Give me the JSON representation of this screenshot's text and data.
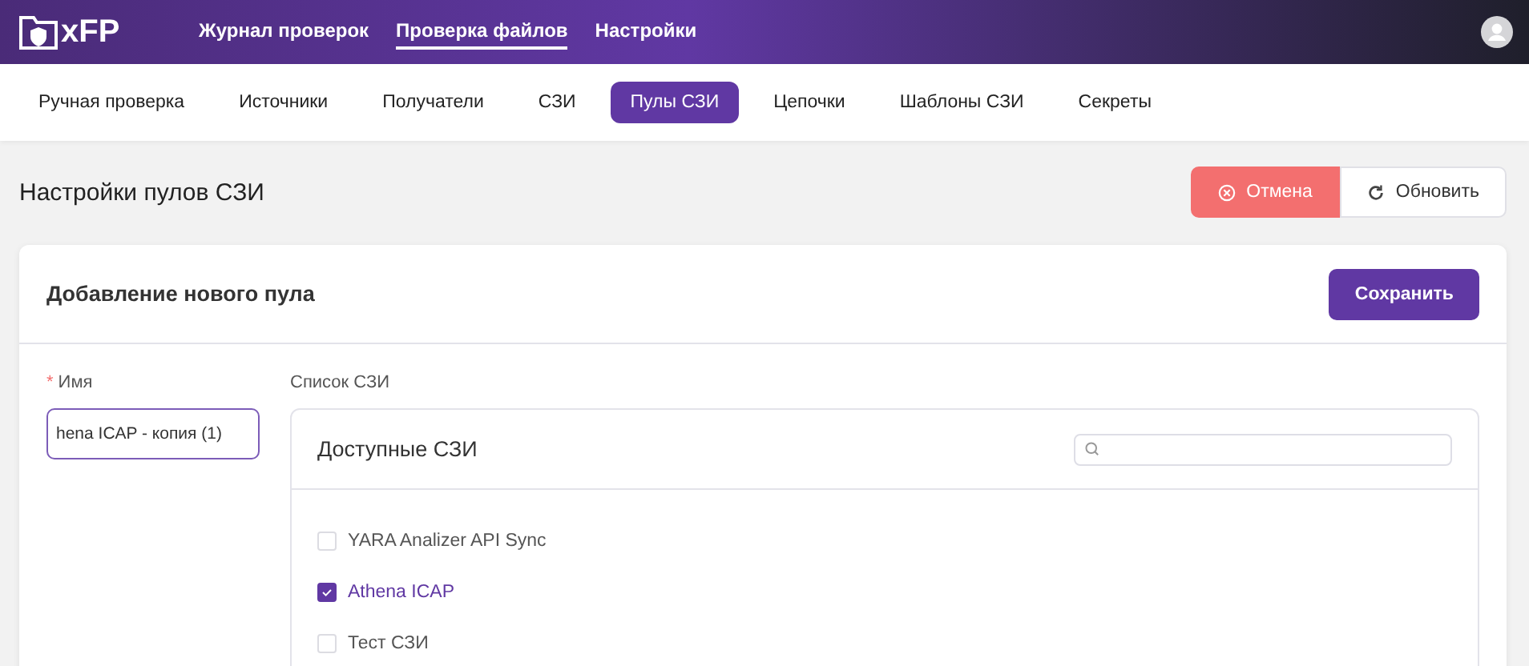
{
  "header": {
    "logo_text": "xFP",
    "nav": [
      {
        "label": "Журнал проверок",
        "selected": false
      },
      {
        "label": "Проверка файлов",
        "selected": true
      },
      {
        "label": "Настройки",
        "selected": false
      }
    ]
  },
  "subnav": [
    {
      "label": "Ручная проверка",
      "selected": false
    },
    {
      "label": "Источники",
      "selected": false
    },
    {
      "label": "Получатели",
      "selected": false
    },
    {
      "label": "СЗИ",
      "selected": false
    },
    {
      "label": "Пулы СЗИ",
      "selected": true
    },
    {
      "label": "Цепочки",
      "selected": false
    },
    {
      "label": "Шаблоны СЗИ",
      "selected": false
    },
    {
      "label": "Секреты",
      "selected": false
    }
  ],
  "page": {
    "title": "Настройки пулов СЗИ",
    "buttons": [
      {
        "label": "Отмена",
        "kind": "cancel"
      },
      {
        "label": "Обновить",
        "kind": "refresh"
      }
    ]
  },
  "card": {
    "title": "Добавление нового пула",
    "save_button": "Сохранить",
    "name_field": {
      "label": "Имя",
      "required_mark": "*",
      "value": "hena ICAP - копия (1)"
    },
    "list_label": "Список СЗИ",
    "list": {
      "title": "Доступные СЗИ",
      "items": [
        {
          "label": "YARA Analizer API Sync",
          "checked": false
        },
        {
          "label": "Athena ICAP",
          "checked": true
        },
        {
          "label": "Тест СЗИ",
          "checked": false
        }
      ]
    }
  }
}
